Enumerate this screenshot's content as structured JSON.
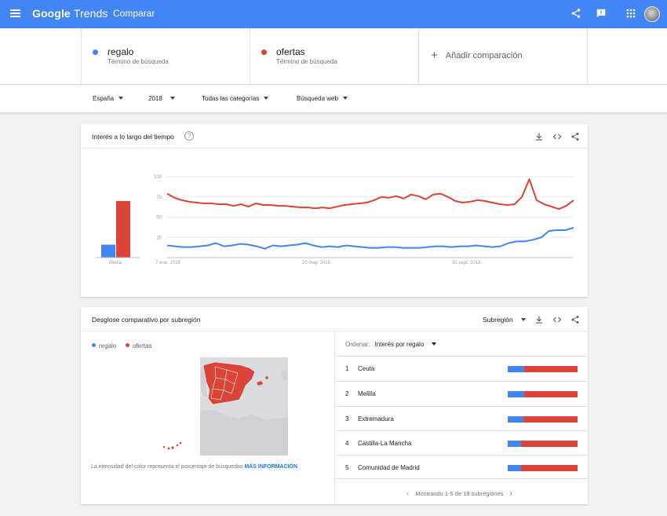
{
  "app": {
    "logo_google": "Google",
    "logo_trends": "Trends",
    "page_title": "Comparar"
  },
  "colors": {
    "accent": "#4285f4",
    "series_1": "#4285f4",
    "series_2": "#db4437"
  },
  "terms": [
    {
      "name": "regalo",
      "sub": "Término de búsqueda",
      "color": "#4285f4"
    },
    {
      "name": "ofertas",
      "sub": "Término de búsqueda",
      "color": "#db4437"
    }
  ],
  "add_comparison": "Añadir comparación",
  "filters": {
    "region": "España",
    "year": "2018",
    "category": "Todas las categorías",
    "search_type": "Búsqueda web"
  },
  "time_card": {
    "title": "Interés a lo largo del tiempo",
    "help": "?"
  },
  "chart_data": {
    "type": "line",
    "title": "Interés a lo largo del tiempo",
    "ylim": [
      0,
      100
    ],
    "yticks": [
      "25",
      "50",
      "75",
      "100"
    ],
    "xticks": [
      "7 ene. 2018",
      "20 may. 2018",
      "30 sept. 2018"
    ],
    "average_label": "Media",
    "averages": [
      16,
      70
    ],
    "grid": true,
    "series": [
      {
        "name": "regalo",
        "values": [
          15,
          14,
          13,
          13,
          14,
          15,
          18,
          14,
          15,
          17,
          16,
          14,
          11,
          15,
          14,
          15,
          16,
          18,
          15,
          13,
          14,
          13,
          15,
          14,
          13,
          12,
          12,
          13,
          13,
          12,
          12,
          12,
          13,
          14,
          14,
          13,
          14,
          14,
          15,
          14,
          13,
          14,
          18,
          20,
          20,
          22,
          25,
          33,
          34,
          34,
          37
        ]
      },
      {
        "name": "ofertas",
        "values": [
          79,
          74,
          71,
          69,
          68,
          67,
          67,
          66,
          66,
          64,
          66,
          63,
          67,
          65,
          65,
          64,
          64,
          63,
          62,
          62,
          61,
          62,
          61,
          63,
          65,
          66,
          67,
          68,
          71,
          75,
          74,
          76,
          73,
          78,
          76,
          72,
          78,
          79,
          75,
          70,
          68,
          69,
          71,
          70,
          68,
          66,
          65,
          66,
          75,
          97,
          71,
          66,
          63,
          60,
          64,
          71
        ]
      }
    ]
  },
  "region_card": {
    "title": "Desglose comparativo por subregión",
    "selector": "Subregión",
    "legend": [
      "regalo",
      "ofertas"
    ],
    "note": "La intensidad del color representa el porcentaje de búsquedas",
    "note_link": "MÁS INFORMACIÓN",
    "sort_label": "Ordenar:",
    "sort_value": "Interés por regalo",
    "rows": [
      {
        "rank": "1",
        "name": "Ceuta",
        "share_1": 0.24
      },
      {
        "rank": "2",
        "name": "Melilla",
        "share_1": 0.24
      },
      {
        "rank": "3",
        "name": "Extremadura",
        "share_1": 0.22
      },
      {
        "rank": "4",
        "name": "Castilla-La Mancha",
        "share_1": 0.19
      },
      {
        "rank": "5",
        "name": "Comunidad de Madrid",
        "share_1": 0.19
      }
    ],
    "pager": "Mostrando 1-5 de 19 subregiones"
  }
}
